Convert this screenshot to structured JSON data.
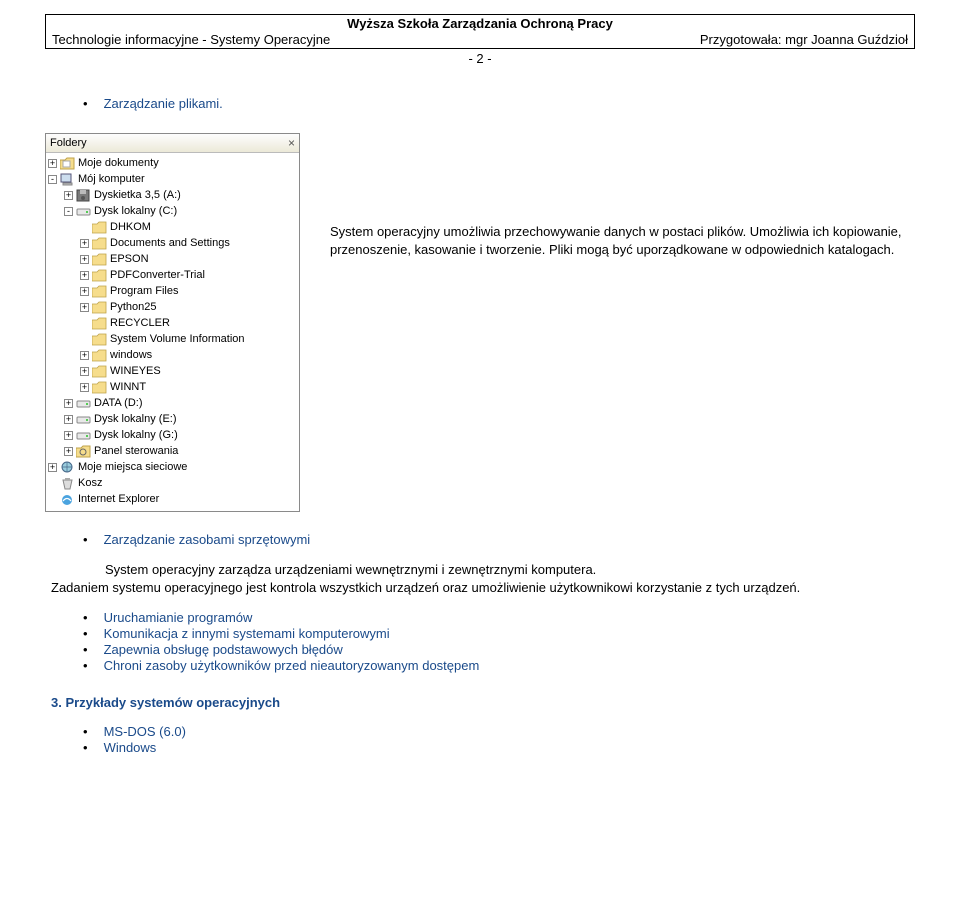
{
  "header": {
    "title": "Wyższa Szkoła Zarządzania Ochroną Pracy",
    "left": "Technologie informacyjne - Systemy Operacyjne",
    "right": "Przygotowała: mgr Joanna Guździoł",
    "page": "- 2 -"
  },
  "section_files": "Zarządzanie plikami.",
  "folder_pane": {
    "header": "Foldery",
    "close": "×"
  },
  "tree": [
    {
      "depth": 0,
      "exp": "+",
      "icon": "mydocs",
      "label": "Moje dokumenty"
    },
    {
      "depth": 0,
      "exp": "-",
      "icon": "computer",
      "label": "Mój komputer"
    },
    {
      "depth": 1,
      "exp": "+",
      "icon": "floppy",
      "label": "Dyskietka 3,5 (A:)"
    },
    {
      "depth": 1,
      "exp": "-",
      "icon": "drive",
      "label": "Dysk lokalny (C:)"
    },
    {
      "depth": 2,
      "exp": "",
      "icon": "folder",
      "label": "DHKOM"
    },
    {
      "depth": 2,
      "exp": "+",
      "icon": "folder",
      "label": "Documents and Settings"
    },
    {
      "depth": 2,
      "exp": "+",
      "icon": "folder",
      "label": "EPSON"
    },
    {
      "depth": 2,
      "exp": "+",
      "icon": "folder",
      "label": "PDFConverter-Trial"
    },
    {
      "depth": 2,
      "exp": "+",
      "icon": "folder",
      "label": "Program Files"
    },
    {
      "depth": 2,
      "exp": "+",
      "icon": "folder",
      "label": "Python25"
    },
    {
      "depth": 2,
      "exp": "",
      "icon": "folder",
      "label": "RECYCLER"
    },
    {
      "depth": 2,
      "exp": "",
      "icon": "folder",
      "label": "System Volume Information"
    },
    {
      "depth": 2,
      "exp": "+",
      "icon": "folder",
      "label": "windows"
    },
    {
      "depth": 2,
      "exp": "+",
      "icon": "folder",
      "label": "WINEYES"
    },
    {
      "depth": 2,
      "exp": "+",
      "icon": "folder",
      "label": "WINNT"
    },
    {
      "depth": 1,
      "exp": "+",
      "icon": "drive",
      "label": "DATA (D:)"
    },
    {
      "depth": 1,
      "exp": "+",
      "icon": "drive",
      "label": "Dysk lokalny (E:)"
    },
    {
      "depth": 1,
      "exp": "+",
      "icon": "drive",
      "label": "Dysk lokalny (G:)"
    },
    {
      "depth": 1,
      "exp": "+",
      "icon": "control",
      "label": "Panel sterowania"
    },
    {
      "depth": 0,
      "exp": "+",
      "icon": "network",
      "label": "Moje miejsca sieciowe"
    },
    {
      "depth": 0,
      "exp": "",
      "icon": "recycle",
      "label": "Kosz"
    },
    {
      "depth": 0,
      "exp": "",
      "icon": "ie",
      "label": "Internet Explorer"
    }
  ],
  "right_para": "System operacyjny umożliwia przechowywanie danych w postaci plików. Umożliwia ich kopiowanie, przenoszenie, kasowanie i tworzenie. Pliki mogą być uporządkowane w odpowiednich katalogach.",
  "section_hw": "Zarządzanie zasobami sprzętowymi",
  "hw_para_1": "System operacyjny zarządza urządzeniami wewnętrznymi i zewnętrznymi komputera.",
  "hw_para_2": "Zadaniem systemu operacyjnego jest kontrola wszystkich urządzeń oraz umożliwienie użytkownikowi korzystanie z tych urządzeń.",
  "bullets": [
    "Uruchamianie programów",
    "Komunikacja z innymi systemami komputerowymi",
    "Zapewnia obsługę podstawowych błędów",
    "Chroni zasoby użytkowników przed nieautoryzowanym dostępem"
  ],
  "examples_heading": "3. Przykłady systemów operacyjnych",
  "examples": [
    "MS-DOS (6.0)",
    "Windows"
  ]
}
